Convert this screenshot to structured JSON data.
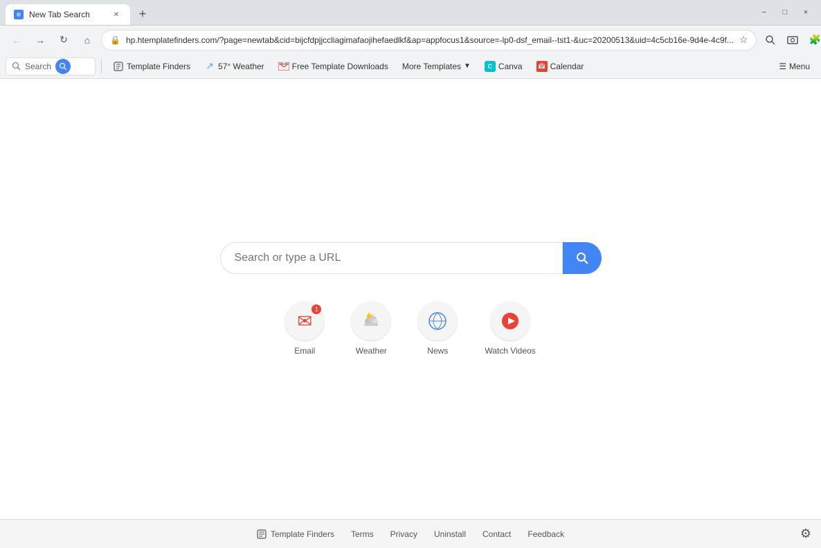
{
  "browser": {
    "tab": {
      "title": "New Tab Search",
      "favicon": "🔍"
    },
    "url": "hp.htemplatefinders.com/?page=newtab&cid=bijcfdpjjccliagimafaojihefaedlkf&ap=appfocus1&source=-lp0-dsf_email--tst1-&uc=20200513&uid=4c5cb16e-9d4e-4c9f...",
    "window_controls": {
      "minimize": "−",
      "maximize": "□",
      "close": "×"
    }
  },
  "toolbar": {
    "search_placeholder": "Search",
    "search_button_label": "🔍",
    "template_finders_label": "Template Finders",
    "weather_label": "57° Weather",
    "free_templates_label": "Free Template Downloads",
    "more_templates_label": "More Templates",
    "canva_label": "Canva",
    "calendar_label": "Calendar",
    "menu_label": "Menu"
  },
  "main": {
    "search_placeholder": "Search or type a URL",
    "search_button_label": "🔍",
    "quick_links": [
      {
        "label": "Email",
        "icon": "✉",
        "badge": "1"
      },
      {
        "label": "Weather",
        "icon": "🌤",
        "badge": null
      },
      {
        "label": "News",
        "icon": "🌐",
        "badge": null
      },
      {
        "label": "Watch Videos",
        "icon": "▶",
        "badge": null
      }
    ]
  },
  "footer": {
    "logo_label": "Template Finders",
    "links": [
      {
        "label": "Terms"
      },
      {
        "label": "Privacy"
      },
      {
        "label": "Uninstall"
      },
      {
        "label": "Contact"
      },
      {
        "label": "Feedback"
      }
    ],
    "settings_icon": "⚙"
  }
}
